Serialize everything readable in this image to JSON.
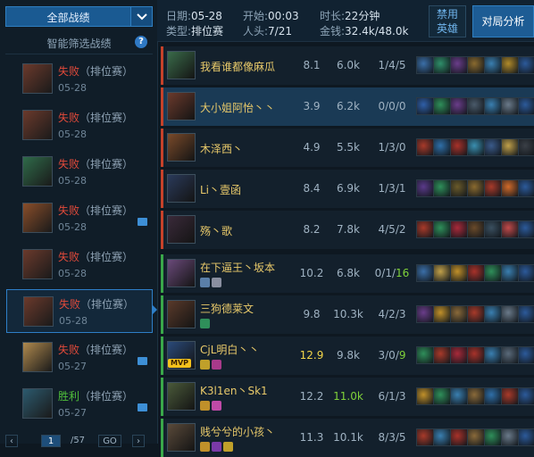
{
  "sidebar": {
    "filter_label": "全部战绩",
    "smart_filter_label": "智能筛选战绩",
    "help_label": "?",
    "matches": [
      {
        "result": "失败",
        "mode": "（排位赛）",
        "date": "05-28",
        "win": false,
        "pic": false,
        "avatar_color": "#6b3a2c"
      },
      {
        "result": "失败",
        "mode": "（排位赛）",
        "date": "05-28",
        "win": false,
        "pic": false,
        "avatar_color": "#6b3a2c"
      },
      {
        "result": "失败",
        "mode": "（排位赛）",
        "date": "05-28",
        "win": false,
        "pic": false,
        "avatar_color": "#2f6b4a"
      },
      {
        "result": "失败",
        "mode": "（排位赛）",
        "date": "05-28",
        "win": false,
        "pic": true,
        "avatar_color": "#8a4e2a"
      },
      {
        "result": "失败",
        "mode": "（排位赛）",
        "date": "05-28",
        "win": false,
        "pic": false,
        "avatar_color": "#6b3a2c"
      },
      {
        "result": "失败",
        "mode": "（排位赛）",
        "date": "05-28",
        "win": false,
        "pic": false,
        "avatar_color": "#6b3a2c"
      },
      {
        "result": "失败",
        "mode": "（排位赛）",
        "date": "05-27",
        "win": false,
        "pic": true,
        "avatar_color": "#b08a4e"
      },
      {
        "result": "胜利",
        "mode": "（排位赛）",
        "date": "05-27",
        "win": true,
        "pic": true,
        "avatar_color": "#2c5a6e"
      }
    ],
    "pager": {
      "current": "1",
      "total": "/57",
      "go": "GO"
    }
  },
  "header": {
    "date_label": "日期:",
    "date_value": "05-28",
    "start_label": "开始:",
    "start_value": "00:03",
    "duration_label": "时长:",
    "duration_value": "22分钟",
    "type_label": "类型:",
    "type_value": "排位赛",
    "players_label": "人头:",
    "players_value": "7/21",
    "gold_label": "金钱:",
    "gold_value": "32.4k/48.0k",
    "ban_button": "禁用\n英雄",
    "analyze_button": "对局分析"
  },
  "players": [
    {
      "name": "我看谁都像麻瓜",
      "score": "8.1",
      "gold": "6.0k",
      "k": "1/4/",
      "a": "5",
      "team": "red",
      "hl": false,
      "champ": "#3a6b4a",
      "badges": [],
      "mvp": false,
      "score_hi": false,
      "gold_hi": false,
      "a_hi": false,
      "items": [
        "#3b6fa8",
        "#2f8f6a",
        "#6a3d8a",
        "#8a6a2f",
        "#3a7fb0",
        "#b08a2a",
        "#2c5a9a"
      ]
    },
    {
      "name": "大小姐阿怡丶丶",
      "score": "3.9",
      "gold": "6.2k",
      "k": "0/0/",
      "a": "0",
      "team": "red",
      "hl": true,
      "champ": "#6b3a2c",
      "badges": [],
      "mvp": false,
      "score_hi": false,
      "gold_hi": false,
      "a_hi": false,
      "items": [
        "#2f5fa8",
        "#2f8f5a",
        "#6a3d8a",
        "#4a5a6a",
        "#3a7fb0",
        "#6a7a8a",
        "#2c5a9a"
      ]
    },
    {
      "name": "木泽西丶",
      "score": "4.9",
      "gold": "5.5k",
      "k": "1/3/",
      "a": "0",
      "team": "red",
      "hl": false,
      "champ": "#7a4a2a",
      "badges": [],
      "mvp": false,
      "score_hi": false,
      "gold_hi": false,
      "a_hi": false,
      "items": [
        "#a83a2a",
        "#2f6fa8",
        "#a8322a",
        "#3a8fb0",
        "#3a5a8a",
        "#c0a04a",
        "#3a3f46"
      ]
    },
    {
      "name": "Li丶壹函",
      "score": "8.4",
      "gold": "6.9k",
      "k": "1/3/",
      "a": "1",
      "team": "red",
      "hl": false,
      "champ": "#2a3a5a",
      "badges": [],
      "mvp": false,
      "score_hi": false,
      "gold_hi": false,
      "a_hi": false,
      "items": [
        "#5a3a8a",
        "#2f8f5a",
        "#6a5a2a",
        "#8a6a2f",
        "#a83a2a",
        "#d06a2a",
        "#2c5a9a"
      ]
    },
    {
      "name": "殇丶歌",
      "score": "8.2",
      "gold": "7.8k",
      "k": "4/5/",
      "a": "2",
      "team": "red",
      "hl": false,
      "champ": "#3a2a3a",
      "badges": [],
      "mvp": false,
      "score_hi": false,
      "gold_hi": false,
      "a_hi": false,
      "items": [
        "#a83a2a",
        "#2f8f5a",
        "#a82a3a",
        "#6a4a2a",
        "#3a4f5f",
        "#c04a4a",
        "#2c5a9a"
      ]
    },
    {
      "name": "在下逼王丶坂本",
      "score": "10.2",
      "gold": "6.8k",
      "k": "0/1/",
      "a": "16",
      "team": "green",
      "hl": false,
      "champ": "#6a4a7a",
      "badges": [
        [
          "#5a7fa8",
          "#8a8fa0"
        ]
      ],
      "mvp": false,
      "score_hi": false,
      "gold_hi": false,
      "a_hi": true,
      "items": [
        "#3b6fa8",
        "#c0a04a",
        "#c0902a",
        "#a8322a",
        "#2f8f5a",
        "#3a7fb0",
        "#2c5a9a"
      ]
    },
    {
      "name": "三狗德莱文",
      "score": "9.8",
      "gold": "10.3k",
      "k": "4/2/",
      "a": "3",
      "team": "green",
      "hl": false,
      "champ": "#5a3a2a",
      "badges": [
        [
          "#2f8f5a"
        ]
      ],
      "mvp": false,
      "score_hi": false,
      "gold_hi": false,
      "a_hi": false,
      "items": [
        "#6a3d8a",
        "#c0902a",
        "#8a6a3a",
        "#a83a2a",
        "#3a7fb0",
        "#6a7a8a",
        "#2c5a9a"
      ]
    },
    {
      "name": "CjL明白丶丶",
      "score": "12.9",
      "gold": "9.8k",
      "k": "3/0/",
      "a": "9",
      "team": "green",
      "hl": false,
      "champ": "#2a4a7a",
      "badges": [
        [
          "#c0a02a",
          "#a83a8a"
        ]
      ],
      "mvp": true,
      "score_hi": true,
      "gold_hi": false,
      "a_hi": true,
      "items": [
        "#2f8f5a",
        "#a83a2a",
        "#a82a3a",
        "#a8322a",
        "#3a7fb0",
        "#5a6a7a",
        "#2c5a9a"
      ]
    },
    {
      "name": "K3l1en丶Sk1",
      "score": "12.2",
      "gold": "11.0k",
      "k": "6/1/",
      "a": "3",
      "team": "green",
      "hl": false,
      "champ": "#4a5a3a",
      "badges": [
        [
          "#c0902a",
          "#c04aa8"
        ]
      ],
      "mvp": false,
      "score_hi": false,
      "gold_hi": true,
      "a_hi": false,
      "items": [
        "#c0902a",
        "#2f8f5a",
        "#3a7fb0",
        "#8a6a3a",
        "#2f6fa8",
        "#a83a2a",
        "#2c5a9a"
      ]
    },
    {
      "name": "贱兮兮的小孩丶",
      "score": "11.3",
      "gold": "10.1k",
      "k": "8/",
      "a": "3/5",
      "team": "green",
      "hl": false,
      "champ": "#5a4a3a",
      "badges": [
        [
          "#c0902a",
          "#7a3aa8",
          "#c0a02a"
        ]
      ],
      "mvp": false,
      "score_hi": false,
      "gold_hi": false,
      "a_hi": false,
      "items": [
        "#a83a2a",
        "#3a7fb0",
        "#a8322a",
        "#8a6a3a",
        "#2f8f5a",
        "#6a7a8a",
        "#2c5a9a"
      ]
    }
  ],
  "colors": {
    "red_side": "#c6422a",
    "green_side": "#3aa84a",
    "accent": "#2e7fc8"
  }
}
